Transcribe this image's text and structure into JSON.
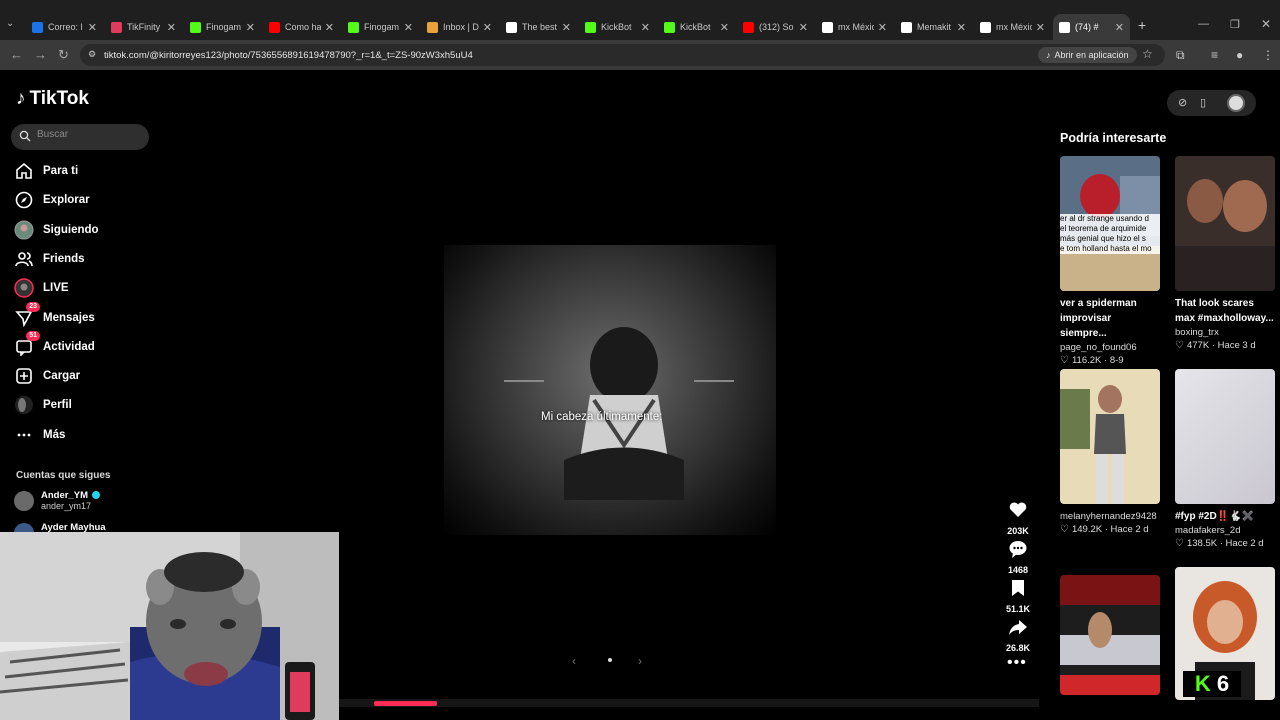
{
  "browser": {
    "tabs": [
      {
        "title": "Correo: l",
        "color": "#1a73e8"
      },
      {
        "title": "TikFinity",
        "color": "#e03a5c"
      },
      {
        "title": "Finogam",
        "color": "#53fc18"
      },
      {
        "title": "Como ha",
        "color": "#ff0000"
      },
      {
        "title": "Finogam",
        "color": "#53fc18"
      },
      {
        "title": "Inbox | D",
        "color": "#e8a33a"
      },
      {
        "title": "The best",
        "color": "#ffffff"
      },
      {
        "title": "KickBot",
        "color": "#53fc18"
      },
      {
        "title": "KickBot",
        "color": "#53fc18"
      },
      {
        "title": "(312) So",
        "color": "#ff0000"
      },
      {
        "title": "mx Méxic",
        "color": "#ffffff"
      },
      {
        "title": "Memakit",
        "color": "#ffffff"
      },
      {
        "title": "mx Méxic",
        "color": "#ffffff"
      },
      {
        "title": "(74) #",
        "color": "#ffffff"
      }
    ],
    "url": "tiktok.com/@kiritorreyes123/photo/7536556891619478790?_r=1&_t=ZS-90zW3xh5uU4",
    "open_in_app": "Abrir en aplicación"
  },
  "sidebar": {
    "logo": "TikTok",
    "search_placeholder": "Buscar",
    "nav": [
      {
        "label": "Para ti",
        "icon": "home-icon"
      },
      {
        "label": "Explorar",
        "icon": "compass-icon"
      },
      {
        "label": "Siguiendo",
        "icon": "following-avatar-icon"
      },
      {
        "label": "Friends",
        "icon": "friends-icon"
      },
      {
        "label": "LIVE",
        "icon": "live-icon"
      },
      {
        "label": "Mensajes",
        "icon": "messages-icon",
        "badge": "23"
      },
      {
        "label": "Actividad",
        "icon": "activity-icon",
        "badge": "51"
      },
      {
        "label": "Cargar",
        "icon": "upload-icon"
      },
      {
        "label": "Perfil",
        "icon": "profile-icon"
      },
      {
        "label": "Más",
        "icon": "more-icon"
      }
    ],
    "following_heading": "Cuentas que sigues",
    "following": [
      {
        "name": "Ander_YM",
        "user": "ander_ym17",
        "verified": true
      },
      {
        "name": "Ayder Mayhua",
        "user": ""
      }
    ]
  },
  "post": {
    "caption": "Mi cabeza últimamente:",
    "progress": 0.09,
    "actions": {
      "likes": "203K",
      "comments": "1468",
      "saves": "51.1K",
      "shares": "26.8K"
    }
  },
  "recommendations": {
    "title": "Podría interesarte",
    "items": [
      {
        "title": "ver a spiderman improvisar siempre...",
        "user": "page_no_found06",
        "likes": "116.2K",
        "date": "8-9"
      },
      {
        "title": "That look scares max #maxholloway...",
        "user": "boxing_trx",
        "likes": "477K",
        "date": "Hace 3 d"
      },
      {
        "title": "",
        "user": "melanyhernandez9428",
        "likes": "149.2K",
        "date": "Hace 2 d"
      },
      {
        "title": "#fyp #2D‼️🐇✖️",
        "user": "madafakers_2d",
        "likes": "138.5K",
        "date": "Hace 2 d"
      },
      {
        "title": "",
        "user": "",
        "likes": "",
        "date": ""
      },
      {
        "title": "",
        "user": "",
        "likes": "",
        "date": ""
      }
    ],
    "thumb_texts": [
      "er al dr strange usando d",
      "el teorema de arquimide",
      "más genial que hizo el s",
      "e tom holland hasta el mo"
    ],
    "overlay_number": "6"
  }
}
